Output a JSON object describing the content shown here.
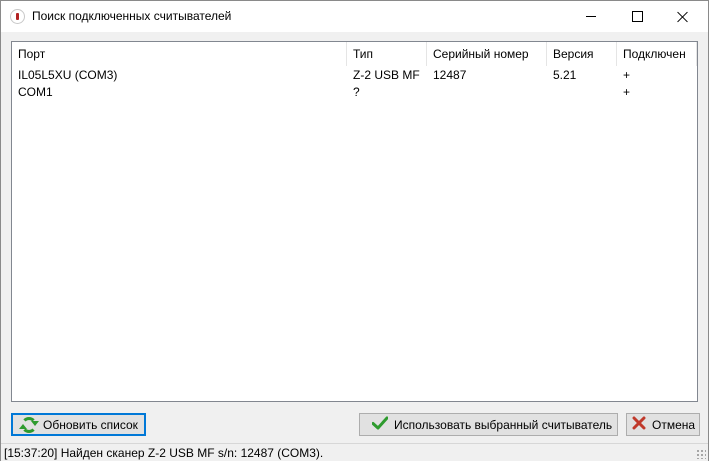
{
  "window": {
    "title": "Поиск подключенных считывателей"
  },
  "list": {
    "columns": [
      "Порт",
      "Тип",
      "Серийный номер",
      "Версия",
      "Подключен"
    ],
    "rows": [
      [
        "IL05L5XU (COM3)",
        "Z-2 USB MF",
        "12487",
        "5.21",
        "+"
      ],
      [
        "COM1",
        "?",
        "",
        "",
        "+"
      ]
    ]
  },
  "buttons": {
    "refresh": "Обновить список",
    "use_selected": "Использовать выбранный считыватель",
    "cancel": "Отмена"
  },
  "status": {
    "text": "[15:37:20] Найден сканер Z-2 USB MF s/n: 12487 (COM3)."
  },
  "icons": {
    "app": "app-icon",
    "refresh": "refresh-icon",
    "use": "check-icon",
    "cancel": "x-icon"
  },
  "colors": {
    "focus_border": "#0078d7",
    "check": "#2e9b2e",
    "cancel_x": "#c0392b"
  }
}
